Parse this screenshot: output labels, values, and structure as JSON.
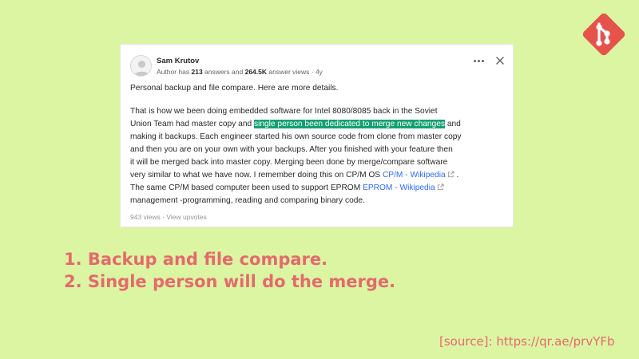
{
  "logo": {
    "icon": "git-logo-icon",
    "color": "#e5534b"
  },
  "answer": {
    "author": {
      "name": "Sam Krutov",
      "meta_prefix": "Author has ",
      "answers": "213",
      "meta_mid": " answers and ",
      "answer_views": "264.5K",
      "meta_suffix": " answer views · 4y"
    },
    "menu_icon": "more-horizontal-icon",
    "close_icon": "close-icon",
    "intro": "Personal backup and file compare. Here are more details.",
    "body": {
      "l1": "That is how we been doing embedded software for Intel 8080/8085 back in the Soviet",
      "l2_pre": "Union Team had master copy and ",
      "l2_highlight": "single person been dedicated to merge new changes",
      "l2_post": " and",
      "l3": "making it backups. Each engineer started his own source code from clone from master copy",
      "l4": "and then you are on your own with your backups. After you finished with your feature then",
      "l5": "it will be merged back into master copy. Merging been done by merge/compare software",
      "l6_pre": "very similar to what we have now. I remember doing this on CP/M OS ",
      "l6_link": "CP/M - Wikipedia",
      "l6_post": " .",
      "l7_pre": "The same CP/M based computer been used to support EPROM ",
      "l7_link": "EPROM - Wikipedia",
      "l8": "management -programming, reading and comparing binary code."
    },
    "views": "943 views",
    "views_sep": " · ",
    "upvotes_link": "View upvotes",
    "highlight_color": "#13a06f",
    "link_color": "#2e69ff"
  },
  "points": [
    "1. Backup and file compare.",
    "2. Single person will do the merge."
  ],
  "source": "[source]: https://qr.ae/prvYFb",
  "colors": {
    "background": "#dcf5a3",
    "accent_text": "#e56a6c"
  }
}
